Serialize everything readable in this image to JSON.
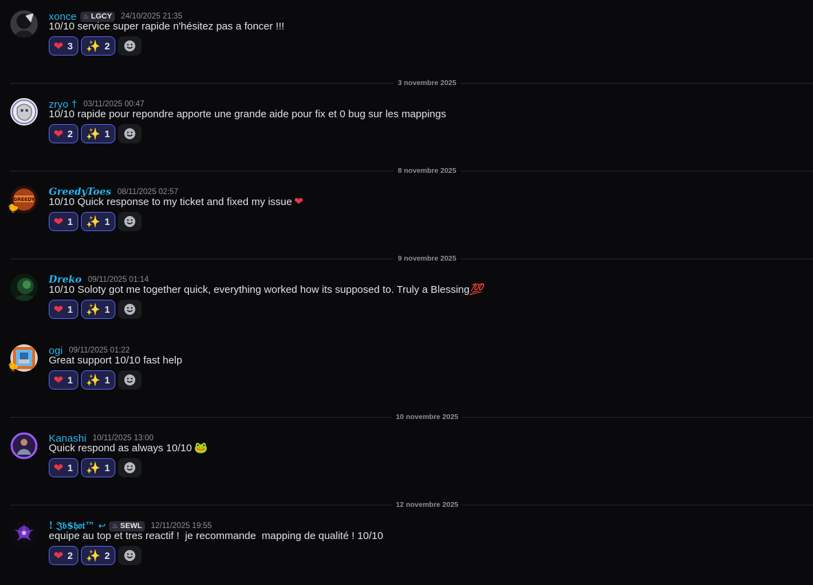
{
  "messages": [
    {
      "username": "xonce",
      "tag": "LGCY",
      "timestamp": "24/10/2025 21:35",
      "content": "10/10 service super rapide n'hésitez pas a foncer !!!",
      "reactions": {
        "heart": "3",
        "sparkles": "2"
      },
      "avatar_icon": "dark-avatar"
    },
    {
      "username": "zryo †",
      "timestamp": "03/11/2025 00:47",
      "content": "10/10 rapide pour repondre apporte une grande aide pour fix et 0 bug sur les mappings",
      "reactions": {
        "heart": "2",
        "sparkles": "1"
      },
      "avatar_icon": "sketch-avatar"
    },
    {
      "username": "GreedyToes",
      "timestamp": "08/11/2025 02:57",
      "content": "10/10 Quick response to my ticket and fixed my issue",
      "content_emoji": "❤",
      "reactions": {
        "heart": "1",
        "sparkles": "1"
      },
      "avatar_icon": "greedy-avatar"
    },
    {
      "username": "Dreko",
      "timestamp": "09/11/2025 01:14",
      "content": "10/10 Soloty got me together quick, everything worked how its supposed to. Truly a Blessing",
      "content_emoji": "💯",
      "reactions": {
        "heart": "1",
        "sparkles": "1"
      },
      "avatar_icon": "green-avatar"
    },
    {
      "username": "ogi",
      "timestamp": "09/11/2025 01:22",
      "content": "Great support 10/10 fast help",
      "reactions": {
        "heart": "1",
        "sparkles": "1"
      },
      "avatar_icon": "pixel-avatar"
    },
    {
      "username": "Kanashi",
      "timestamp": "10/11/2025 13:00",
      "content": "Quick respond as always 10/10",
      "content_emoji": "🐸",
      "reactions": {
        "heart": "1",
        "sparkles": "1"
      },
      "avatar_icon": "purple-ring-avatar"
    },
    {
      "username": "! 𝔍𝔟$𝔥𝔬𝔱™",
      "username_suffix": "↩",
      "tag": "SEWL",
      "timestamp": "12/11/2025 19:55",
      "content": "equipe au top et tres reactif !  je recommande  mapping de qualité ! 10/10",
      "reactions": {
        "heart": "2",
        "sparkles": "2"
      },
      "avatar_icon": "purple-flower-avatar"
    }
  ],
  "dividers": [
    "3 novembre 2025",
    "8 novembre 2025",
    "9 novembre 2025",
    "10 novembre 2025",
    "12 novembre 2025"
  ],
  "icons": {
    "reaction_heart": "heart-emoji",
    "reaction_sparkles": "sparkles-emoji",
    "add_reaction": "smiley-icon",
    "tag": "purple-flame-icon"
  },
  "colors": {
    "background": "#0a0a0c",
    "username": "#24b7f2",
    "reaction_border": "#5865f2",
    "reaction_bg": "#20224a",
    "heart": "#e8354a"
  }
}
